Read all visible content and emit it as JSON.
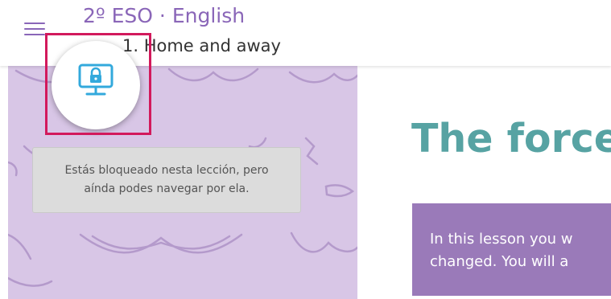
{
  "header": {
    "course": "2º ESO · English",
    "unit": "1. Home and away"
  },
  "lock": {
    "tooltip_line1": "Estás bloqueado nesta lección, pero",
    "tooltip_line2": "aínda podes navegar por ela."
  },
  "lesson": {
    "title": "The force",
    "intro_line1": "In this lesson you w",
    "intro_line2": "changed. You will a"
  },
  "colors": {
    "brand_purple": "#8a66b8",
    "highlight": "#d2195c",
    "title_teal": "#57a3a3",
    "intro_bg": "#9a7ab9",
    "lock_icon": "#33a9dc"
  },
  "icons": {
    "menu": "menu-icon",
    "lock": "locked-computer-icon"
  }
}
